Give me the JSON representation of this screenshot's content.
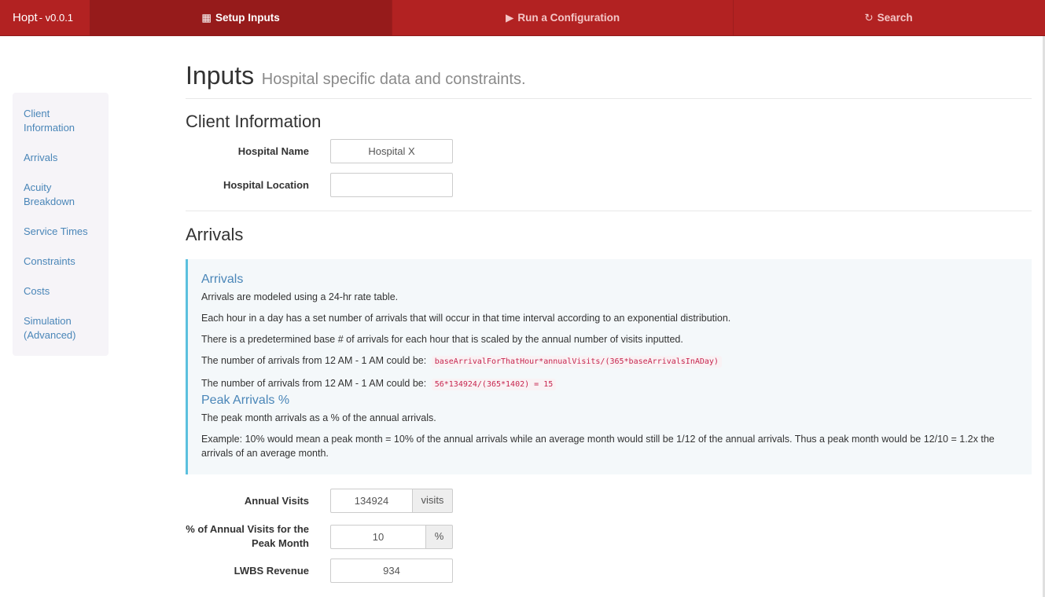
{
  "navbar": {
    "brand": "Hopt",
    "version": "- v0.0.1",
    "items": [
      {
        "label": "Setup Inputs",
        "icon": "table-icon",
        "glyph": "▦"
      },
      {
        "label": "Run a Configuration",
        "icon": "play-icon",
        "glyph": "▶"
      },
      {
        "label": "Search",
        "icon": "refresh-icon",
        "glyph": "↻"
      }
    ],
    "colors": {
      "bar": "#b22222",
      "active": "#961b1b"
    }
  },
  "sidebar": {
    "items": [
      {
        "label": "Client Information"
      },
      {
        "label": "Arrivals"
      },
      {
        "label": "Acuity Breakdown"
      },
      {
        "label": "Service Times"
      },
      {
        "label": "Constraints"
      },
      {
        "label": "Costs"
      },
      {
        "label": "Simulation (Advanced)"
      }
    ]
  },
  "header": {
    "title": "Inputs",
    "subtitle": "Hospital specific data and constraints."
  },
  "client_info": {
    "title": "Client Information",
    "hospital_name_label": "Hospital Name",
    "hospital_name_value": "Hospital X",
    "hospital_location_label": "Hospital Location",
    "hospital_location_value": ""
  },
  "arrivals": {
    "title": "Arrivals",
    "callout": {
      "heading1": "Arrivals",
      "p1": "Arrivals are modeled using a 24-hr rate table.",
      "p2": "Each hour in a day has a set number of arrivals that will occur in that time interval according to an exponential distribution.",
      "p3": "There is a predetermined base # of arrivals for each hour that is scaled by the annual number of visits inputted.",
      "p4_text": "The number of arrivals from 12 AM - 1 AM could be:",
      "p4_code": "baseArrivalForThatHour*annualVisits/(365*baseArrivalsInADay)",
      "p5_text": "The number of arrivals from 12 AM - 1 AM could be:",
      "p5_code": "56*134924/(365*1402) = 15",
      "heading2": "Peak Arrivals %",
      "p6": "The peak month arrivals as a % of the annual arrivals.",
      "p7": "Example: 10% would mean a peak month = 10% of the annual arrivals while an average month would still be 1/12 of the annual arrivals. Thus a peak month would be 12/10 = 1.2x the arrivals of an average month."
    },
    "annual_visits_label": "Annual Visits",
    "annual_visits_value": "134924",
    "annual_visits_unit": "visits",
    "peak_label": "% of Annual Visits for the Peak Month",
    "peak_value": "10",
    "peak_unit": "%",
    "lwbs_label": "LWBS Revenue",
    "lwbs_value": "934"
  }
}
